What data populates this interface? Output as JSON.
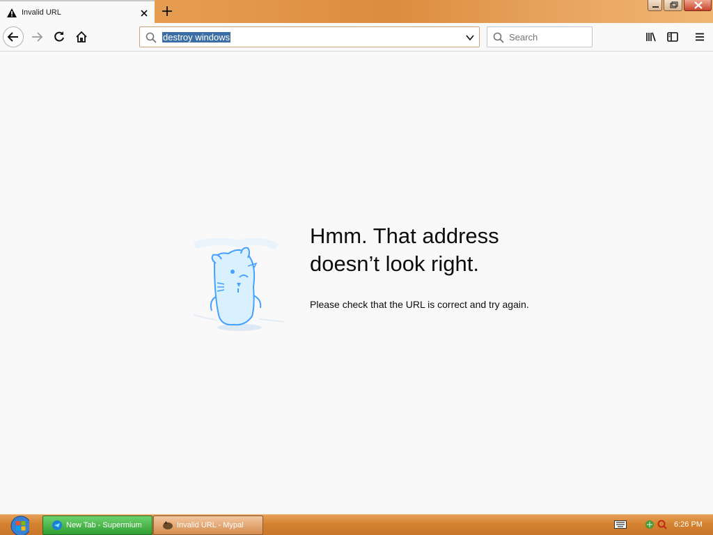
{
  "tab": {
    "title": "Invalid URL"
  },
  "urlbar": {
    "value": "destroy windows"
  },
  "search": {
    "placeholder": "Search"
  },
  "error": {
    "title_line1": "Hmm. That address",
    "title_line2": "doesn’t look right.",
    "description": "Please check that the URL is correct and try again."
  },
  "taskbar": {
    "tasks": [
      {
        "label": "New Tab - Supermium"
      },
      {
        "label": "Invalid URL - Mypal"
      }
    ],
    "clock": "6:26 PM"
  },
  "colors": {
    "accent_url_highlight": "#3a6ea5",
    "taskbar_orange": "#d4822f",
    "task_active_green": "#2f9d2f",
    "illustration_blue": "#45a1ff"
  },
  "icons": [
    "warning-icon",
    "close-icon",
    "plus-icon",
    "back-arrow-icon",
    "forward-arrow-icon",
    "reload-icon",
    "home-icon",
    "search-icon",
    "chevron-down-icon",
    "library-icon",
    "sidebar-icon",
    "hamburger-menu-icon",
    "windows-start-icon",
    "keyboard-icon"
  ]
}
